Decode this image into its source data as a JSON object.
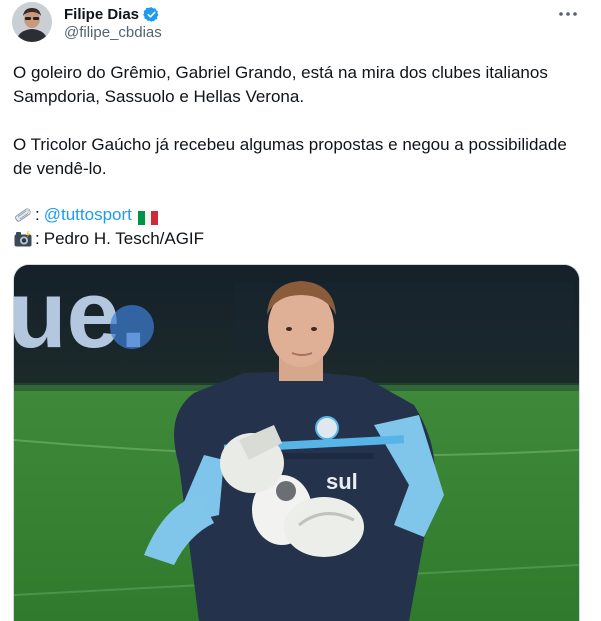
{
  "author": {
    "display_name": "Filipe Dias",
    "handle": "@filipe_cbdias",
    "verified": true
  },
  "tweet": {
    "paragraphs": [
      "O goleiro do Grêmio, Gabriel Grando, está na mira dos clubes italianos Sampdoria, Sassuolo e Hellas Verona.",
      "O Tricolor Gaúcho já recebeu algumas propostas e negou a possibilidade de vendê-lo."
    ],
    "credits": [
      {
        "icon": "newspaper-roll-icon",
        "separator": ":",
        "text": "@tuttosport",
        "is_link": true,
        "trailing_icon": "italy-flag-icon"
      },
      {
        "icon": "camera-flash-icon",
        "separator": ":",
        "text": "Pedro H. Tesch/AGIF",
        "is_link": false
      }
    ]
  },
  "media": {
    "stadium_sign_text": "ue.",
    "jersey_text": "sul"
  },
  "colors": {
    "link": "#1d9bf0",
    "verified": "#1d9bf0",
    "text": "#0f1419",
    "muted": "#536471"
  }
}
